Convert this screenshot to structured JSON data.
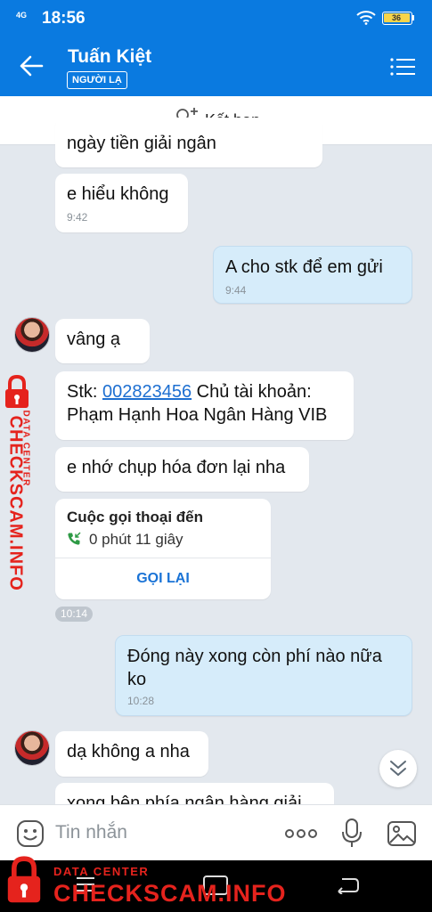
{
  "status_bar": {
    "network": "4G",
    "time": "18:56",
    "battery": "36"
  },
  "header": {
    "contact_name": "Tuấn Kiệt",
    "badge": "NGƯỜI LẠ"
  },
  "add_friend": {
    "label": "Kết bạn"
  },
  "messages": [
    {
      "from": "them",
      "text": "ngày tiền giải ngân"
    },
    {
      "from": "them",
      "text": "e hiểu không",
      "time": "9:42"
    },
    {
      "from": "me",
      "text": "A cho stk để em gửi",
      "time": "9:44"
    },
    {
      "from": "them",
      "text": "vâng ạ"
    },
    {
      "from": "them",
      "text_prefix": "Stk: ",
      "account": "002823456",
      "text_mid": " Chủ tài khoản:",
      "text_line2": "Phạm Hạnh Hoa Ngân Hàng VIB"
    },
    {
      "from": "them",
      "text": "e nhớ chụp hóa đơn lại nha"
    },
    {
      "from": "me",
      "text_line1": "Đóng này xong còn phí nào nữa",
      "text_line2": "ko",
      "time": "10:28"
    },
    {
      "from": "them",
      "text": "dạ không a nha"
    },
    {
      "from": "them",
      "text": "xong bên phía ngân hàng giải"
    }
  ],
  "call": {
    "title": "Cuộc gọi thoại đến",
    "duration": "0 phút 11 giây",
    "action": "GỌI LẠI",
    "time": "10:14"
  },
  "composer": {
    "placeholder": "Tin nhắn"
  },
  "watermark": {
    "small": "DATA CENTER",
    "big": "CHECKSCAM.INFO"
  },
  "colors": {
    "header": "#0a7ae0",
    "my_bubble": "#d6ecfa",
    "link": "#1d6fd1",
    "watermark": "#e5231d"
  }
}
